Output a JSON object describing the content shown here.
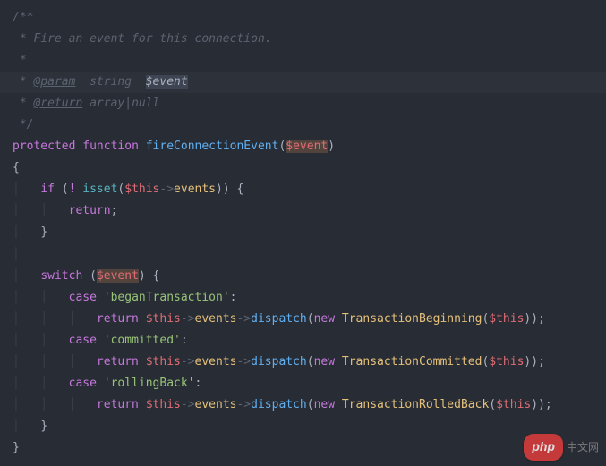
{
  "doc": {
    "l1": "/**",
    "l2_pre": " * ",
    "l2_text": "Fire an event for this connection.",
    "l3": " *",
    "l4_pre": " * ",
    "l4_tag": "@param",
    "l4_type": "  string  ",
    "l4_var": "$event",
    "l5_pre": " * ",
    "l5_tag": "@return",
    "l5_type": " array",
    "l5_pipe": "|",
    "l5_null": "null",
    "l6": " */"
  },
  "code": {
    "protected": "protected",
    "function": "function",
    "fn_name": "fireConnectionEvent",
    "param": "$event",
    "if": "if",
    "not": "! ",
    "isset": "isset",
    "this": "$this",
    "arrow": "->",
    "events": "events",
    "return": "return",
    "switch": "switch",
    "case": "case",
    "began": "'beganTransaction'",
    "committed": "'committed'",
    "rolling": "'rollingBack'",
    "dispatch": "dispatch",
    "new": "new",
    "TransactionBeginning": "TransactionBeginning",
    "TransactionCommitted": "TransactionCommitted",
    "TransactionRolledBack": "TransactionRolledBack"
  },
  "watermark": {
    "pill": "php",
    "text": "中文网"
  }
}
